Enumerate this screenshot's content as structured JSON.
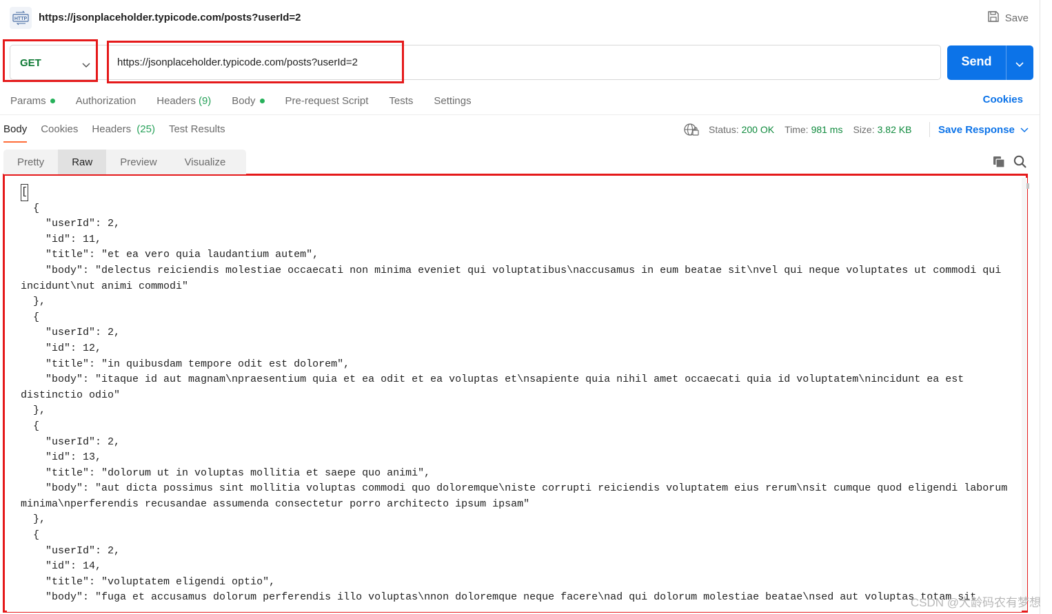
{
  "header": {
    "title": "https://jsonplaceholder.typicode.com/posts?userId=2",
    "save_label": "Save"
  },
  "request": {
    "method": "GET",
    "url": "https://jsonplaceholder.typicode.com/posts?userId=2",
    "send_label": "Send"
  },
  "request_tabs": [
    {
      "label": "Params"
    },
    {
      "label": "Authorization"
    },
    {
      "label": "Headers",
      "count": "(9)"
    },
    {
      "label": "Body"
    },
    {
      "label": "Pre-request Script"
    },
    {
      "label": "Tests"
    },
    {
      "label": "Settings"
    }
  ],
  "cookies_link": "Cookies",
  "response_tabs": [
    {
      "label": "Body"
    },
    {
      "label": "Cookies"
    },
    {
      "label": "Headers",
      "count": "(25)"
    },
    {
      "label": "Test Results"
    }
  ],
  "status": {
    "status_label": "Status:",
    "status_value": "200 OK",
    "time_label": "Time:",
    "time_value": "981 ms",
    "size_label": "Size:",
    "size_value": "3.82 KB"
  },
  "save_response_label": "Save Response",
  "view_tabs": [
    {
      "label": "Pretty"
    },
    {
      "label": "Raw"
    },
    {
      "label": "Preview"
    },
    {
      "label": "Visualize"
    }
  ],
  "response_body": {
    "open_bracket": "[",
    "text": "\n  {\n    \"userId\": 2,\n    \"id\": 11,\n    \"title\": \"et ea vero quia laudantium autem\",\n    \"body\": \"delectus reiciendis molestiae occaecati non minima eveniet qui voluptatibus\\naccusamus in eum beatae sit\\nvel qui neque voluptates ut commodi qui incidunt\\nut animi commodi\"\n  },\n  {\n    \"userId\": 2,\n    \"id\": 12,\n    \"title\": \"in quibusdam tempore odit est dolorem\",\n    \"body\": \"itaque id aut magnam\\npraesentium quia et ea odit et ea voluptas et\\nsapiente quia nihil amet occaecati quia id voluptatem\\nincidunt ea est distinctio odio\"\n  },\n  {\n    \"userId\": 2,\n    \"id\": 13,\n    \"title\": \"dolorum ut in voluptas mollitia et saepe quo animi\",\n    \"body\": \"aut dicta possimus sint mollitia voluptas commodi quo doloremque\\niste corrupti reiciendis voluptatem eius rerum\\nsit cumque quod eligendi laborum minima\\nperferendis recusandae assumenda consectetur porro architecto ipsum ipsam\"\n  },\n  {\n    \"userId\": 2,\n    \"id\": 14,\n    \"title\": \"voluptatem eligendi optio\",\n    \"body\": \"fuga et accusamus dolorum perferendis illo voluptas\\nnon doloremque neque facere\\nad qui dolorum molestiae beatae\\nsed aut voluptas totam sit"
  },
  "watermark": "CSDN @大龄码农有梦想",
  "colors": {
    "accent": "#0c73e8",
    "method_get": "#0f7a35",
    "status_ok": "#0f8a3d",
    "tab_active": "#ff6c37",
    "highlight": "#e5191a"
  }
}
